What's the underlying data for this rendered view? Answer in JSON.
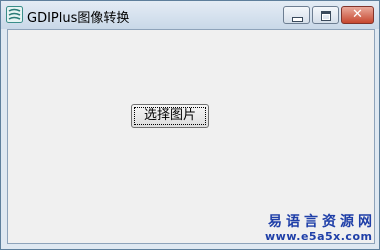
{
  "window": {
    "title": "GDIPlus图像转换",
    "controls": {
      "minimize": "minimize",
      "maximize": "maximize",
      "close": "✕"
    }
  },
  "main": {
    "select_image_button": "选择图片"
  },
  "watermark": {
    "title": "易语言资源网",
    "url": "www.e5a5x.com"
  },
  "colors": {
    "accent": "#1f3fa8",
    "close_button": "#c6472f"
  },
  "icons": {
    "app": "app-icon"
  }
}
